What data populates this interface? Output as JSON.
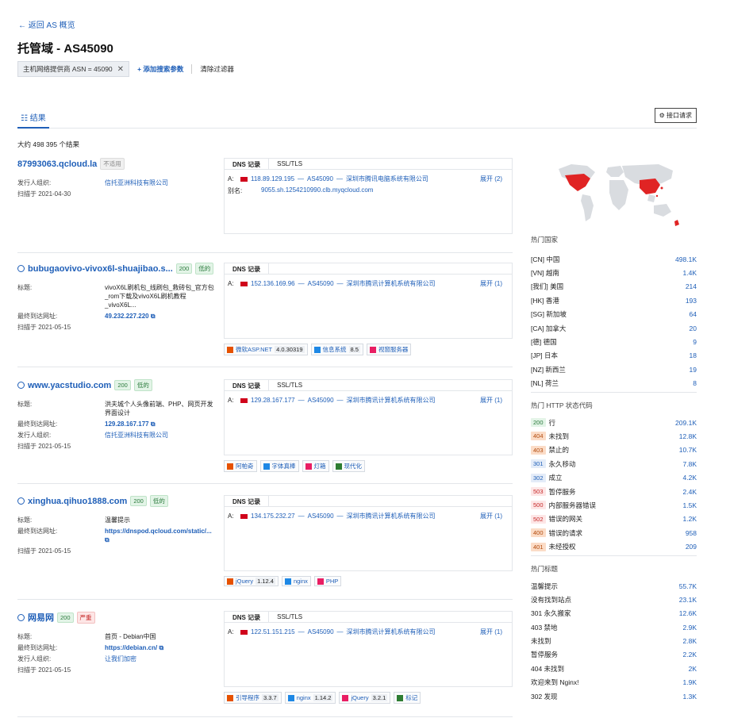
{
  "nav": {
    "back": "← 返回 AS 概览"
  },
  "page": {
    "title": "托管域 - AS45090"
  },
  "filters": {
    "chip": "主机网络提供商 ASN = 45090",
    "add": "+ 添加搜索参数",
    "clear": "清除过滤器"
  },
  "tabs": {
    "results": "☷ 结果",
    "api": "⚙ 接口请求"
  },
  "summary": {
    "count": "大约 498 395 个结果"
  },
  "results": [
    {
      "host": "87993063.qcloud.la",
      "badges": [
        "不适用"
      ],
      "fields": [
        {
          "k": "发行人组织:",
          "v": "信托亚洲科技有限公司"
        }
      ],
      "scan": "扫描于 2021-04-30",
      "tabs": [
        "DNS 记录",
        "SSL/TLS"
      ],
      "dns": {
        "label": "A:",
        "ip": "118.89.129.195",
        "asn": "AS45090",
        "org": "深圳市腾讯电脑系统有限公司",
        "expand": "展开 (2)"
      },
      "alias": {
        "label": "别名:",
        "v": "9055.sh.1254210990.clb.myqcloud.com"
      },
      "techs": []
    },
    {
      "host": "bubugaovivo-vivox6l-shuajibao.s...",
      "badges": [
        "200",
        "低的"
      ],
      "fields": [
        {
          "k": "标题:",
          "v": "vivoX6L刷机包_线刷包_救砖包_官方包_rom下载及vivoX6L刷机教程_vivoX6L..."
        },
        {
          "k": "最终到达网址:",
          "v": "49.232.227.220 ⧉"
        }
      ],
      "scan": "扫描于 2021-05-15",
      "tabs": [
        "DNS 记录"
      ],
      "dns": {
        "label": "A:",
        "ip": "152.136.169.96",
        "asn": "AS45090",
        "org": "深圳市腾讯计算机系统有限公司",
        "expand": "展开 (1)"
      },
      "techs": [
        {
          "name": "微软ASP.NET",
          "ver": "4.0.30319"
        },
        {
          "name": "信息系统",
          "ver": "8.5"
        },
        {
          "name": "视窗服务器",
          "ver": ""
        }
      ]
    },
    {
      "host": "www.yacstudio.com",
      "badges": [
        "200",
        "低的"
      ],
      "fields": [
        {
          "k": "标题:",
          "v": "洪夫城个人头像前端、PHP、网页开发界面设计"
        },
        {
          "k": "最终到达网址:",
          "v": "129.28.167.177 ⧉"
        },
        {
          "k": "发行人组织:",
          "v": "信托亚洲科技有限公司"
        }
      ],
      "scan": "扫描于 2021-05-15",
      "tabs": [
        "DNS 记录",
        "SSL/TLS"
      ],
      "dns": {
        "label": "A:",
        "ip": "129.28.167.177",
        "asn": "AS45090",
        "org": "深圳市腾讯计算机系统有限公司",
        "expand": "展开 (1)"
      },
      "techs": [
        {
          "name": "阿帕奇",
          "ver": ""
        },
        {
          "name": "字体真棒",
          "ver": ""
        },
        {
          "name": "灯箱",
          "ver": ""
        },
        {
          "name": "现代化",
          "ver": ""
        }
      ]
    },
    {
      "host": "xinghua.qihuo1888.com",
      "badges": [
        "200",
        "低的"
      ],
      "fields": [
        {
          "k": "标题:",
          "v": "温馨提示"
        },
        {
          "k": "最终到达网址:",
          "v": "https://dnspod.qcloud.com/static/... ⧉"
        }
      ],
      "scan": "扫描于 2021-05-15",
      "tabs": [
        "DNS 记录"
      ],
      "dns": {
        "label": "A:",
        "ip": "134.175.232.27",
        "asn": "AS45090",
        "org": "深圳市腾讯计算机系统有限公司",
        "expand": "展开 (1)"
      },
      "techs": [
        {
          "name": "jQuery",
          "ver": "1.12.4"
        },
        {
          "name": "nginx",
          "ver": ""
        },
        {
          "name": "PHP",
          "ver": ""
        }
      ]
    },
    {
      "host": "网易网",
      "badges": [
        "200",
        "严重"
      ],
      "fields": [
        {
          "k": "标题:",
          "v": "首页 - Debian中国"
        },
        {
          "k": "最终到达网址:",
          "v": "https://debian.cn/ ⧉"
        },
        {
          "k": "发行人组织:",
          "v": "让我们加密"
        }
      ],
      "scan": "扫描于 2021-05-15",
      "tabs": [
        "DNS 记录",
        "SSL/TLS"
      ],
      "dns": {
        "label": "A:",
        "ip": "122.51.151.215",
        "asn": "AS45090",
        "org": "深圳市腾讯计算机系统有限公司",
        "expand": "展开 (1)"
      },
      "techs": [
        {
          "name": "引导程序",
          "ver": "3.3.7"
        },
        {
          "name": "nginx",
          "ver": "1.14.2"
        },
        {
          "name": "jQuery",
          "ver": "3.2.1"
        },
        {
          "name": "标记",
          "ver": ""
        }
      ]
    }
  ],
  "sidebar": {
    "countries_title": "热门国家",
    "countries": [
      {
        "l": "[CN] 中国",
        "n": "498.1K"
      },
      {
        "l": "[VN] 越南",
        "n": "1.4K"
      },
      {
        "l": "[我们] 美国",
        "n": "214"
      },
      {
        "l": "[HK] 香港",
        "n": "193"
      },
      {
        "l": "[SG] 新加坡",
        "n": "64"
      },
      {
        "l": "[CA] 加拿大",
        "n": "20"
      },
      {
        "l": "[德] 德国",
        "n": "9"
      },
      {
        "l": "[JP] 日本",
        "n": "18"
      },
      {
        "l": "[NZ] 新西兰",
        "n": "19"
      },
      {
        "l": "[NL] 荷兰",
        "n": "8"
      }
    ],
    "http_title": "热门 HTTP 状态代码",
    "http": [
      {
        "c": "200",
        "l": "行",
        "n": "209.1K"
      },
      {
        "c": "404",
        "l": "未找到",
        "n": "12.8K"
      },
      {
        "c": "403",
        "l": "禁止的",
        "n": "10.7K"
      },
      {
        "c": "301",
        "l": "永久移动",
        "n": "7.8K"
      },
      {
        "c": "302",
        "l": "成立",
        "n": "4.2K"
      },
      {
        "c": "503",
        "l": "暂停服务",
        "n": "2.4K"
      },
      {
        "c": "500",
        "l": "内部服务器错误",
        "n": "1.5K"
      },
      {
        "c": "502",
        "l": "错误的网关",
        "n": "1.2K"
      },
      {
        "c": "400",
        "l": "错误的请求",
        "n": "958"
      },
      {
        "c": "401",
        "l": "未经授权",
        "n": "209"
      }
    ],
    "titles_title": "热门标题",
    "titles": [
      {
        "l": "温馨提示",
        "n": "55.7K"
      },
      {
        "l": "没有找到站点",
        "n": "23.1K"
      },
      {
        "l": "301 永久搬家",
        "n": "12.6K"
      },
      {
        "l": "403 禁地",
        "n": "2.9K"
      },
      {
        "l": "未找到",
        "n": "2.8K"
      },
      {
        "l": "暂停服务",
        "n": "2.2K"
      },
      {
        "l": "404 未找到",
        "n": "2K"
      },
      {
        "l": "欢迎来到 Nginx!",
        "n": "1.9K"
      },
      {
        "l": "302 发现",
        "n": "1.3K"
      }
    ]
  }
}
